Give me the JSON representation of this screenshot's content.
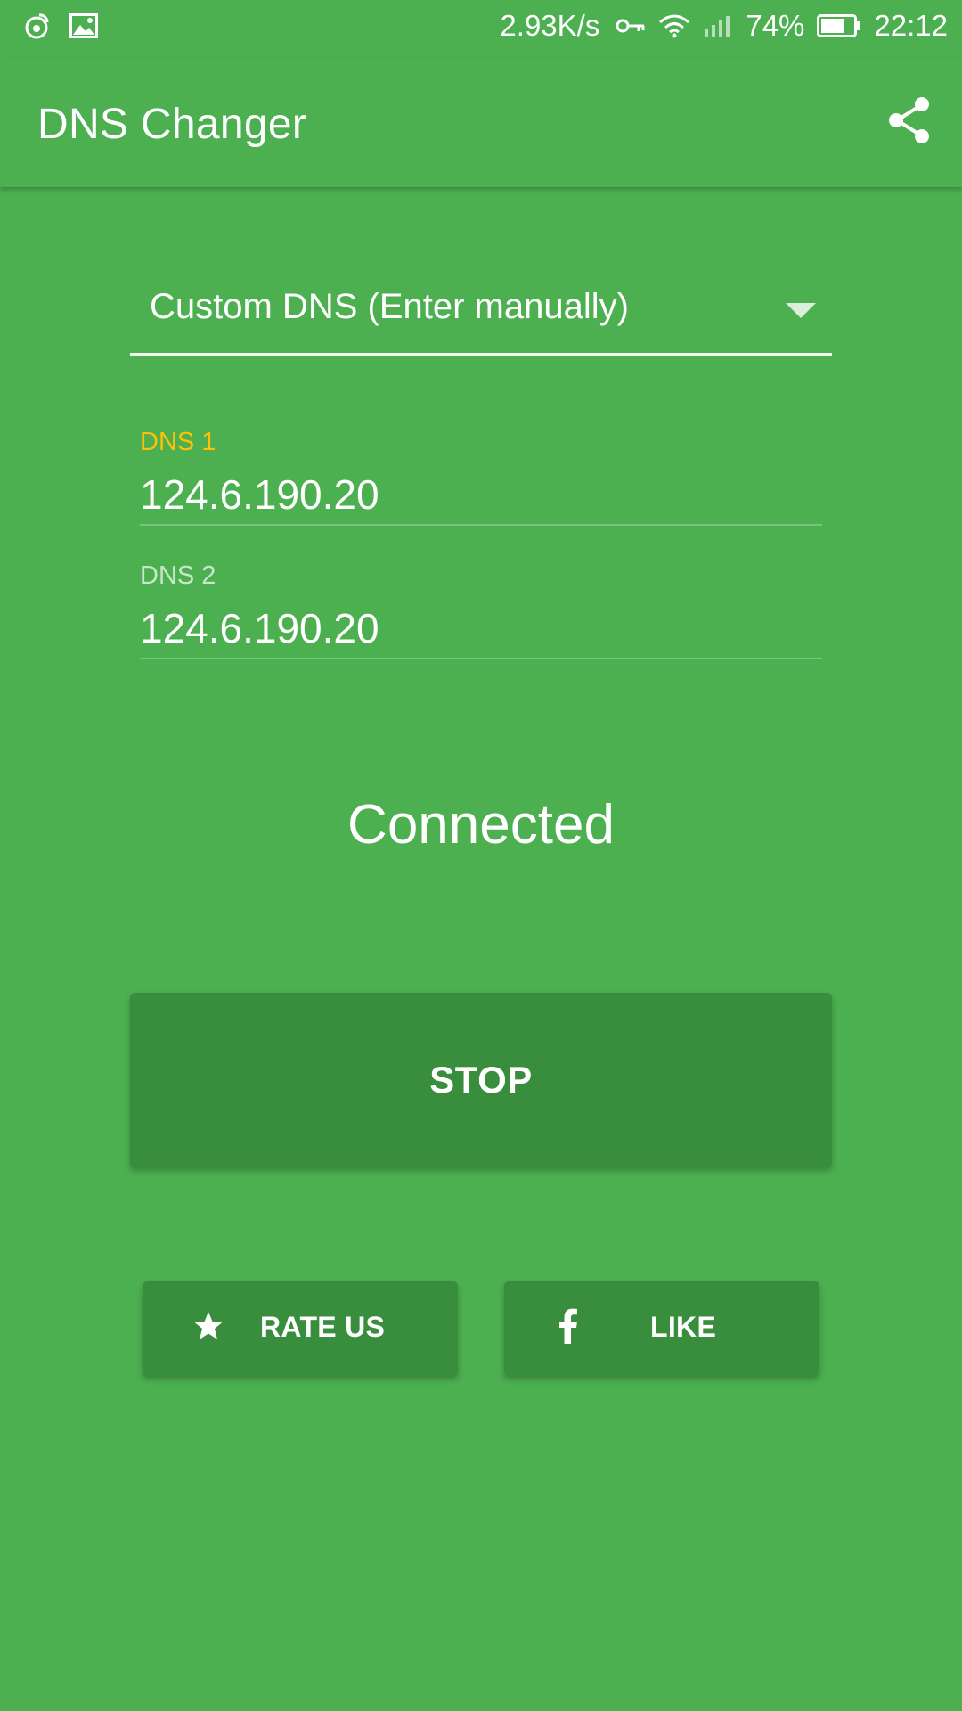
{
  "status_bar": {
    "network_speed": "2.93K/s",
    "battery_percent": "74%",
    "time": "22:12",
    "battery_level": 0.74,
    "icons": [
      "weibo-icon",
      "gallery-icon",
      "vpn-key-icon",
      "wifi-icon",
      "signal-icon",
      "battery-icon"
    ]
  },
  "app_bar": {
    "title": "DNS Changer",
    "share_icon": "share-icon"
  },
  "dns_selector": {
    "selected": "Custom DNS (Enter manually)"
  },
  "fields": {
    "dns1": {
      "label": "DNS 1",
      "value": "124.6.190.20",
      "label_color": "#ffc107"
    },
    "dns2": {
      "label": "DNS 2",
      "value": "124.6.190.20",
      "label_color": "#c8e6c9"
    }
  },
  "connection_status": "Connected",
  "buttons": {
    "stop": "STOP",
    "rate": {
      "label": "RATE US",
      "icon": "star-icon"
    },
    "like": {
      "label": "LIKE",
      "icon": "facebook-icon"
    }
  },
  "colors": {
    "background": "#4caf50",
    "button": "#388e3c",
    "accent": "#ffc107"
  }
}
